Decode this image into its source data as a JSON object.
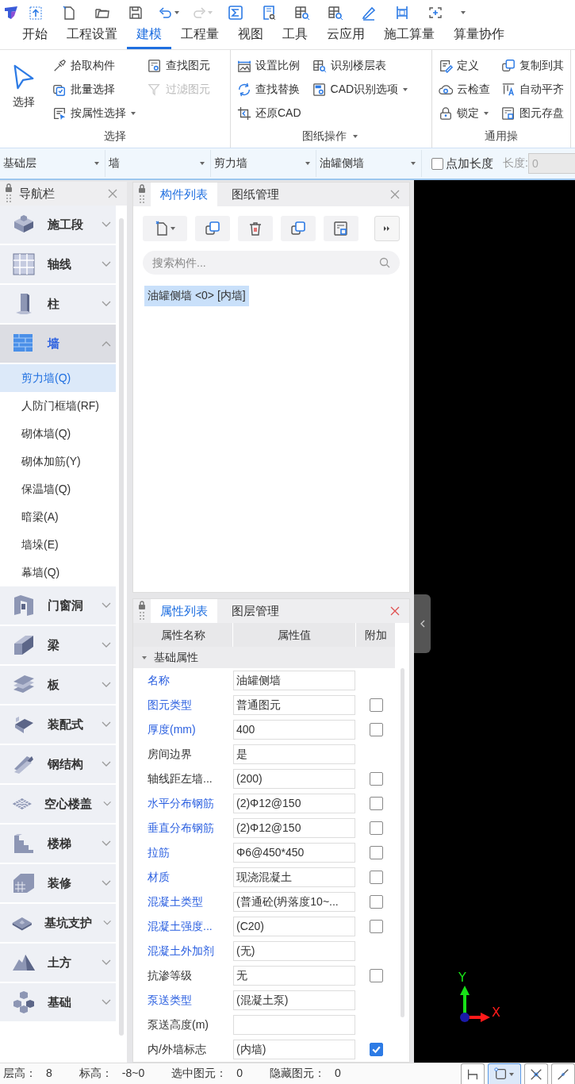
{
  "menu_tabs": [
    {
      "label": "开始",
      "selected": false
    },
    {
      "label": "工程设置",
      "selected": false
    },
    {
      "label": "建模",
      "selected": true
    },
    {
      "label": "工程量",
      "selected": false
    },
    {
      "label": "视图",
      "selected": false
    },
    {
      "label": "工具",
      "selected": false
    },
    {
      "label": "云应用",
      "selected": false
    },
    {
      "label": "施工算量",
      "selected": false
    },
    {
      "label": "算量协作",
      "selected": false
    }
  ],
  "ribbon": {
    "groups": [
      {
        "label": "选择",
        "menu": false,
        "columns": [
          [
            {
              "label": "选择",
              "kind": "large",
              "dropdown": false,
              "disabled": false
            }
          ],
          [
            {
              "label": "拾取构件",
              "kind": "small",
              "dropdown": false,
              "disabled": false
            },
            {
              "label": "批量选择",
              "kind": "small",
              "dropdown": false,
              "disabled": false
            },
            {
              "label": "按属性选择",
              "kind": "small",
              "dropdown": true,
              "disabled": false
            }
          ],
          [
            {
              "label": "查找图元",
              "kind": "small",
              "dropdown": false,
              "disabled": false
            },
            {
              "label": "过滤图元",
              "kind": "small",
              "dropdown": false,
              "disabled": true
            }
          ]
        ]
      },
      {
        "label": "图纸操作",
        "menu": true,
        "columns": [
          [
            {
              "label": "设置比例",
              "kind": "small",
              "dropdown": false,
              "disabled": false
            },
            {
              "label": "查找替换",
              "kind": "small",
              "dropdown": false,
              "disabled": false
            },
            {
              "label": "还原CAD",
              "kind": "small",
              "dropdown": false,
              "disabled": false
            }
          ],
          [
            {
              "label": "识别楼层表",
              "kind": "small",
              "dropdown": false,
              "disabled": false
            },
            {
              "label": "CAD识别选项",
              "kind": "small",
              "dropdown": true,
              "disabled": false
            }
          ]
        ]
      },
      {
        "label": "通用操",
        "menu": false,
        "columns": [
          [
            {
              "label": "定义",
              "kind": "small",
              "dropdown": false,
              "disabled": false
            },
            {
              "label": "云检查",
              "kind": "small",
              "dropdown": false,
              "disabled": false
            },
            {
              "label": "锁定",
              "kind": "small",
              "dropdown": true,
              "disabled": false
            }
          ],
          [
            {
              "label": "复制到其",
              "kind": "small",
              "dropdown": false,
              "disabled": false
            },
            {
              "label": "自动平齐",
              "kind": "small",
              "dropdown": false,
              "disabled": false
            },
            {
              "label": "图元存盘",
              "kind": "small",
              "dropdown": false,
              "disabled": false
            }
          ]
        ]
      }
    ]
  },
  "selector_bar": {
    "combos": [
      {
        "value": "基础层"
      },
      {
        "value": "墙"
      },
      {
        "value": "剪力墙"
      },
      {
        "value": "油罐侧墙"
      }
    ],
    "option": {
      "label": "点加长度",
      "checked": false
    },
    "length": {
      "label": "长度:",
      "value": "0"
    }
  },
  "nav": {
    "title": "导航栏",
    "categories": [
      {
        "label": "施工段",
        "expanded": false
      },
      {
        "label": "轴线",
        "expanded": false
      },
      {
        "label": "柱",
        "expanded": false
      },
      {
        "label": "墙",
        "expanded": true,
        "children": [
          {
            "label": "剪力墙(Q)",
            "selected": true
          },
          {
            "label": "人防门框墙(RF)",
            "selected": false
          },
          {
            "label": "砌体墙(Q)",
            "selected": false
          },
          {
            "label": "砌体加筋(Y)",
            "selected": false
          },
          {
            "label": "保温墙(Q)",
            "selected": false
          },
          {
            "label": "暗梁(A)",
            "selected": false
          },
          {
            "label": "墙垛(E)",
            "selected": false
          },
          {
            "label": "幕墙(Q)",
            "selected": false
          }
        ]
      },
      {
        "label": "门窗洞",
        "expanded": false
      },
      {
        "label": "梁",
        "expanded": false
      },
      {
        "label": "板",
        "expanded": false
      },
      {
        "label": "装配式",
        "expanded": false
      },
      {
        "label": "钢结构",
        "expanded": false
      },
      {
        "label": "空心楼盖",
        "expanded": false
      },
      {
        "label": "楼梯",
        "expanded": false
      },
      {
        "label": "装修",
        "expanded": false
      },
      {
        "label": "基坑支护",
        "expanded": false
      },
      {
        "label": "土方",
        "expanded": false
      },
      {
        "label": "基础",
        "expanded": false
      }
    ]
  },
  "component_panel": {
    "tabs": [
      {
        "label": "构件列表",
        "selected": true
      },
      {
        "label": "图纸管理",
        "selected": false
      }
    ],
    "search": {
      "placeholder": "搜索构件..."
    },
    "items": [
      {
        "label": "油罐侧墙 <0> [内墙]",
        "selected": true
      }
    ]
  },
  "property_panel": {
    "tabs": [
      {
        "label": "属性列表",
        "selected": true
      },
      {
        "label": "图层管理",
        "selected": false
      }
    ],
    "columns": [
      "属性名称",
      "属性值",
      "附加"
    ],
    "group": {
      "label": "基础属性",
      "expanded": true,
      "rows": [
        {
          "name": "名称",
          "color": "#2a5fe0",
          "value": "油罐侧墙"
        },
        {
          "name": "图元类型",
          "color": "#2a5fe0",
          "value": "普通图元",
          "addon": {
            "checked": false
          }
        },
        {
          "name": "厚度(mm)",
          "color": "#2a5fe0",
          "value": "400",
          "addon": {
            "checked": false
          }
        },
        {
          "name": "房间边界",
          "color": "#333333",
          "value": "是"
        },
        {
          "name": "轴线距左墙...",
          "color": "#333333",
          "value": "(200)",
          "addon": {
            "checked": false
          }
        },
        {
          "name": "水平分布钢筋",
          "color": "#2a5fe0",
          "value": "(2)Φ12@150",
          "addon": {
            "checked": false
          }
        },
        {
          "name": "垂直分布钢筋",
          "color": "#2a5fe0",
          "value": "(2)Φ12@150",
          "addon": {
            "checked": false
          }
        },
        {
          "name": "拉筋",
          "color": "#2a5fe0",
          "value": "Φ6@450*450",
          "addon": {
            "checked": false
          }
        },
        {
          "name": "材质",
          "color": "#2a5fe0",
          "value": "现浇混凝土",
          "addon": {
            "checked": false
          }
        },
        {
          "name": "混凝土类型",
          "color": "#2a5fe0",
          "value": "(普通砼(坍落度10~...",
          "addon": {
            "checked": false
          }
        },
        {
          "name": "混凝土强度...",
          "color": "#2a5fe0",
          "value": "(C20)",
          "addon": {
            "checked": false
          }
        },
        {
          "name": "混凝土外加剂",
          "color": "#2a5fe0",
          "value": "(无)"
        },
        {
          "name": "抗渗等级",
          "color": "#333333",
          "value": "无",
          "addon": {
            "checked": false
          }
        },
        {
          "name": "泵送类型",
          "color": "#2a5fe0",
          "value": "(混凝土泵)"
        },
        {
          "name": "泵送高度(m)",
          "color": "#333333"
        },
        {
          "name": "内/外墙标志",
          "color": "#333333",
          "value": "(内墙)",
          "addon": {
            "checked": true
          }
        }
      ]
    }
  },
  "canvas": {
    "x_label": "X",
    "y_label": "Y"
  },
  "status_bar": {
    "items": [
      {
        "label": "层高：",
        "value": "8"
      },
      {
        "label": "标高：",
        "value": "-8~0"
      },
      {
        "label": "选中图元：",
        "value": "0"
      },
      {
        "label": "隐藏图元：",
        "value": "0"
      }
    ],
    "tools": [
      {
        "selected": false
      },
      {
        "selected": true
      },
      {
        "selected": false
      },
      {
        "selected": false
      }
    ]
  }
}
